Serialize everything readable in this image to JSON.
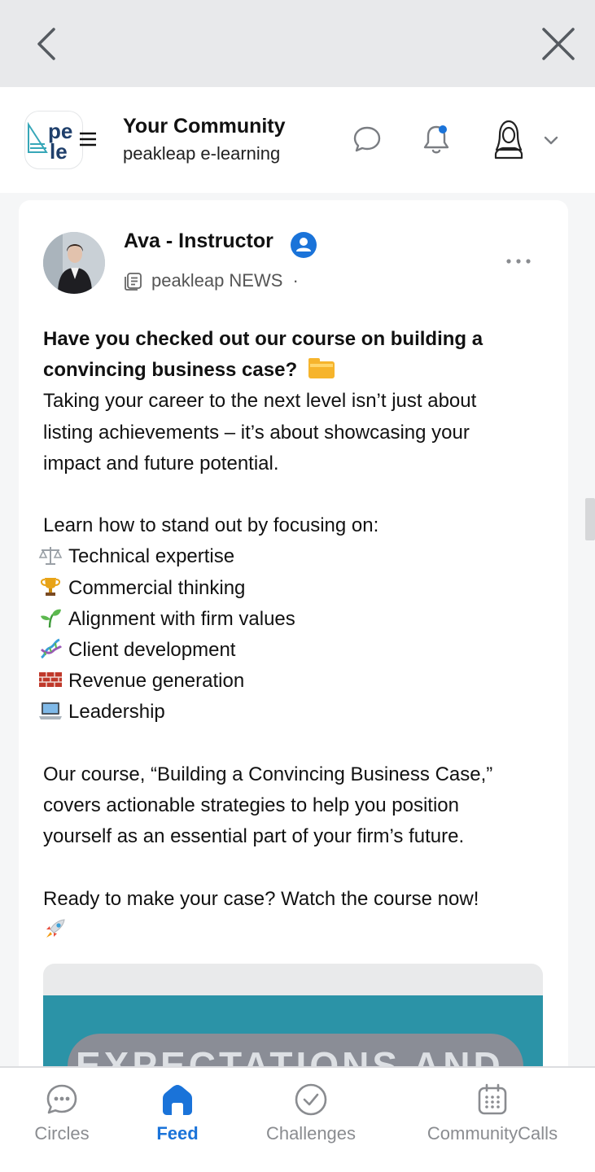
{
  "top_bar": {
    "back_icon": "chevron-left-icon",
    "close_icon": "close-icon"
  },
  "header": {
    "logo_text_line1": "pe",
    "logo_text_line2": "le",
    "community_title": "Your Community",
    "community_subtitle": "peakleap e-learning",
    "icons": [
      "menu-icon",
      "chat-icon",
      "bell-icon",
      "avatar-icon",
      "chevron-down-icon"
    ]
  },
  "post": {
    "author": "Ava - Instructor",
    "channel": "peakleap NEWS",
    "separator": "·",
    "headline_line1": "Have you checked out our course on building a",
    "headline_line2": "convincing business case?",
    "body_lines": [
      "Taking your career to the next level isn’t just about",
      "listing achievements – it’s about showcasing your",
      "impact and future potential."
    ],
    "list_intro": "Learn how to stand out by focusing on:",
    "focus_items": [
      {
        "icon": "scales-emoji",
        "label": "Technical expertise"
      },
      {
        "icon": "trophy-emoji",
        "label": "Commercial thinking"
      },
      {
        "icon": "seedling-emoji",
        "label": "Alignment with firm values"
      },
      {
        "icon": "dna-emoji",
        "label": "Client development"
      },
      {
        "icon": "bricks-emoji",
        "label": "Revenue generation"
      },
      {
        "icon": "laptop-emoji",
        "label": "Leadership"
      }
    ],
    "closing_lines": [
      "Our course, “Building a Convincing Business Case,”",
      "covers actionable strategies to help you position",
      "yourself as an essential part of your firm’s future."
    ],
    "cta_line": "Ready to make your case? Watch the course now!",
    "preview_text": "EXPECTATIONS AND"
  },
  "bottom_nav": {
    "items": [
      {
        "label": "Circles",
        "icon": "chat-bubble-icon",
        "active": false
      },
      {
        "label": "Feed",
        "icon": "home-icon",
        "active": true
      },
      {
        "label": "Challenges",
        "icon": "check-circle-icon",
        "active": false
      },
      {
        "label": "CommunityCalls",
        "icon": "calendar-icon",
        "active": false
      }
    ]
  },
  "colors": {
    "accent": "#1a73d9",
    "topbar_bg": "#e8e9eb",
    "preview_teal": "#2b93a7",
    "inactive_nav": "#8a8c90"
  }
}
